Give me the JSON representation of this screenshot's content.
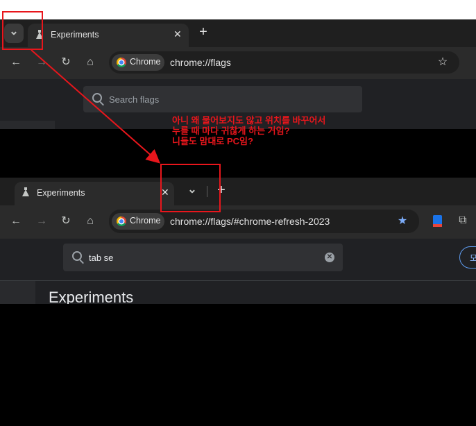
{
  "top_screenshot": {
    "tab": {
      "title": "Experiments",
      "close_glyph": "✕"
    },
    "new_tab_glyph": "+",
    "tab_search_glyph": "⌄",
    "omnibox": {
      "chip_label": "Chrome",
      "url": "chrome://flags"
    },
    "search": {
      "placeholder": "Search flags"
    }
  },
  "bottom_screenshot": {
    "tab": {
      "title": "Experiments",
      "close_glyph": "✕"
    },
    "tab_search_glyph": "⌄",
    "new_tab_glyph": "+",
    "omnibox": {
      "chip_label": "Chrome",
      "url": "chrome://flags/#chrome-refresh-2023"
    },
    "search": {
      "value": "tab se"
    },
    "heading": "Experiments",
    "right_button_partial": "모"
  },
  "annotation": {
    "lines": [
      "아니 왜 물어보지도 않고 위치를 바꾸어서",
      "누를 때 마다 귀찮게 하는 거임?",
      "니들도 맘대로 PC임?"
    ],
    "color": "#e8161c"
  },
  "colors": {
    "tabstrip": "#1f1f1f",
    "toolbar": "#2b2b2b",
    "page": "#202124",
    "star_blue": "#7cacf8"
  },
  "icons": [
    "back-arrow-icon",
    "forward-arrow-icon",
    "reload-icon",
    "home-icon",
    "star-icon",
    "chevron-down-icon",
    "search-icon",
    "clear-icon",
    "extension-icon",
    "puzzle-icon",
    "flask-icon"
  ]
}
